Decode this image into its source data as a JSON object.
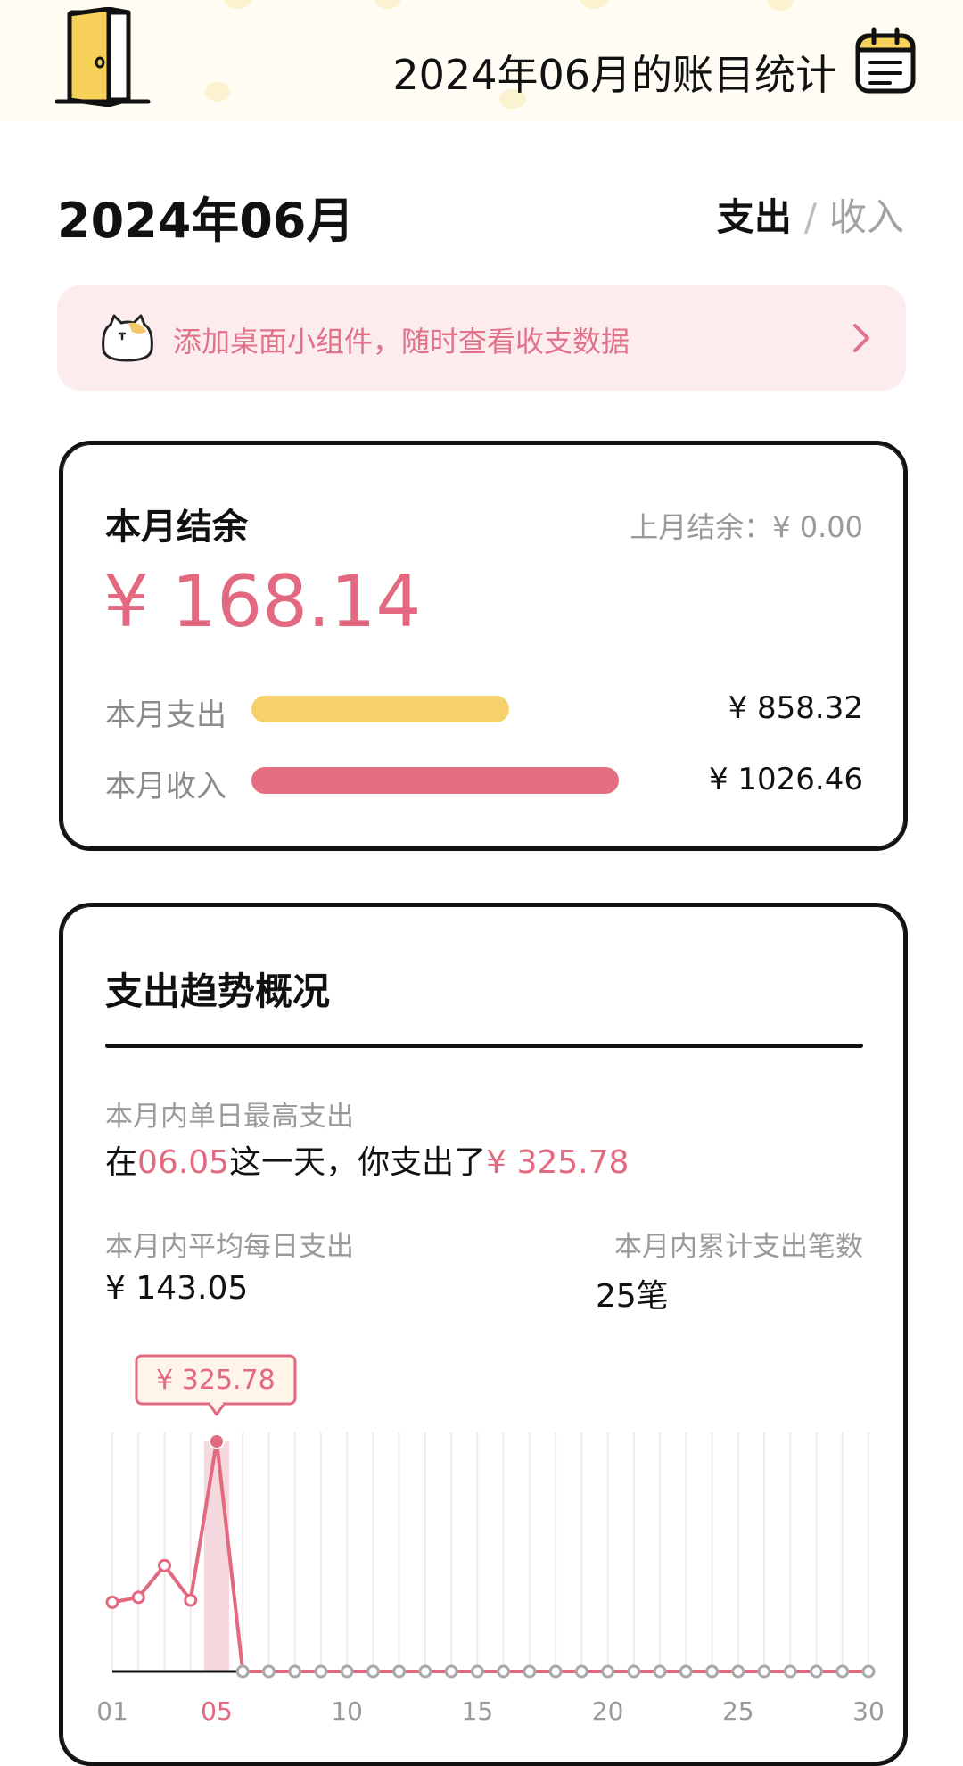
{
  "header": {
    "title": "2024年06月的账目统计",
    "left_icon": "door-icon",
    "right_icon": "calendar-note-icon"
  },
  "month": "2024年06月",
  "toggle": {
    "active": "支出",
    "separator": "/",
    "inactive": "收入"
  },
  "banner": {
    "text": "添加桌面小组件，随时查看收支数据",
    "icon": "cat-icon",
    "chevron": "chevron-right-icon"
  },
  "balance_card": {
    "label": "本月结余",
    "prev_balance": "上月结余：¥ 0.00",
    "amount": "¥ 168.14",
    "expense": {
      "label": "本月支出",
      "amount": "¥ 858.32",
      "value": 858.32
    },
    "income": {
      "label": "本月收入",
      "amount": "¥ 1026.46",
      "value": 1026.46
    }
  },
  "trend_card": {
    "title": "支出趋势概况",
    "max_day": {
      "label": "本月内单日最高支出",
      "prefix": "在",
      "date": "06.05",
      "middle": "这一天，你支出了",
      "amount": "¥ 325.78"
    },
    "avg_daily": {
      "label": "本月内平均每日支出",
      "value": "¥ 143.05"
    },
    "count": {
      "label": "本月内累计支出笔数",
      "value": "25笔"
    },
    "tooltip": "¥ 325.78"
  },
  "colors": {
    "accent_pink": "#e2697f",
    "bar_yellow": "#f6d06a",
    "bar_pink": "#e46f83",
    "banner_bg": "#fcecee"
  },
  "chart_data": {
    "type": "line",
    "x": [
      "01",
      "02",
      "03",
      "04",
      "05",
      "06",
      "07",
      "08",
      "09",
      "10",
      "11",
      "12",
      "13",
      "14",
      "15",
      "16",
      "17",
      "18",
      "19",
      "20",
      "21",
      "22",
      "23",
      "24",
      "25",
      "26",
      "27",
      "28",
      "29",
      "30"
    ],
    "tick_labels": [
      "01",
      "05",
      "10",
      "15",
      "20",
      "25",
      "30"
    ],
    "values": [
      98,
      105,
      150,
      101,
      325.78,
      0,
      0,
      0,
      0,
      0,
      0,
      0,
      0,
      0,
      0,
      0,
      0,
      0,
      0,
      0,
      0,
      0,
      0,
      0,
      0,
      0,
      0,
      0,
      0,
      0
    ],
    "highlight_index": 4,
    "ylim": [
      0,
      325.78
    ],
    "grid": "vertical"
  }
}
